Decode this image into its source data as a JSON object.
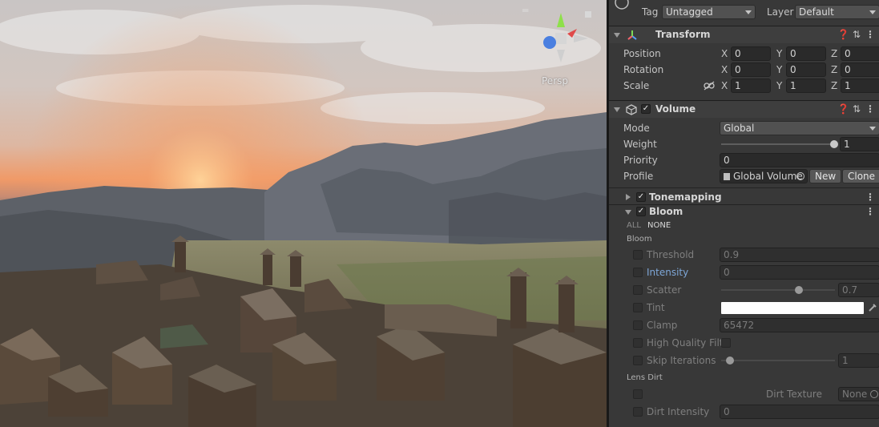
{
  "scene": {
    "camera_mode": "Persp",
    "menu_glyph": "═"
  },
  "inspector": {
    "tag_label": "Tag",
    "tag_value": "Untagged",
    "layer_label": "Layer",
    "layer_value": "Default",
    "transform": {
      "title": "Transform",
      "position_label": "Position",
      "rotation_label": "Rotation",
      "scale_label": "Scale",
      "axis_x": "X",
      "axis_y": "Y",
      "axis_z": "Z",
      "position": [
        "0",
        "0",
        "0"
      ],
      "rotation": [
        "0",
        "0",
        "0"
      ],
      "scale": [
        "1",
        "1",
        "1"
      ]
    },
    "volume": {
      "title": "Volume",
      "mode_label": "Mode",
      "mode_value": "Global",
      "weight_label": "Weight",
      "weight_value": "1",
      "priority_label": "Priority",
      "priority_value": "0",
      "profile_label": "Profile",
      "profile_value": "Global Volume",
      "new_button": "New",
      "clone_button": "Clone"
    },
    "tonemapping": {
      "title": "Tonemapping"
    },
    "bloom": {
      "title": "Bloom",
      "all_label": "ALL",
      "none_label": "NONE",
      "section_bloom": "Bloom",
      "threshold_label": "Threshold",
      "threshold_value": "0.9",
      "intensity_label": "Intensity",
      "intensity_value": "0",
      "scatter_label": "Scatter",
      "scatter_value": "0.7",
      "tint_label": "Tint",
      "clamp_label": "Clamp",
      "clamp_value": "65472",
      "hq_label": "High Quality Filt",
      "skip_label": "Skip Iterations",
      "skip_value": "1",
      "section_lens": "Lens Dirt",
      "dirt_texture_label": "Dirt Texture",
      "dirt_texture_value": "None",
      "dirt_intensity_label": "Dirt Intensity",
      "dirt_intensity_value": "0"
    }
  },
  "colors": {
    "panel_bg": "#383838",
    "header_bg": "#3e3e3e",
    "field_bg": "#2a2a2a",
    "override_blue": "#7ea7d8",
    "gizmo_y": "#8ee04a",
    "gizmo_x": "#e04a4a",
    "gizmo_z": "#4a7fe0"
  }
}
